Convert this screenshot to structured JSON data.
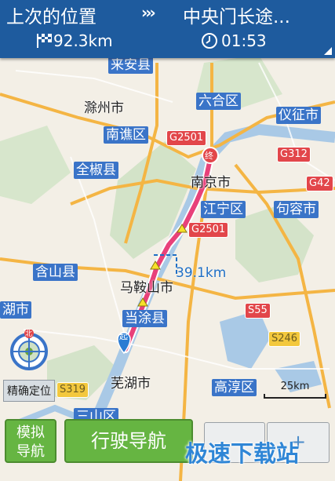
{
  "header": {
    "origin": "上次的位置",
    "destination": "中央门长途...",
    "distance": "92.3km",
    "duration": "01:53"
  },
  "map": {
    "places": [
      {
        "name": "来安县",
        "style": "blue"
      },
      {
        "name": "六合区",
        "style": "blue"
      },
      {
        "name": "滁州市",
        "style": "plain"
      },
      {
        "name": "仪征市",
        "style": "blue"
      },
      {
        "name": "南谯区",
        "style": "blue"
      },
      {
        "name": "全椒县",
        "style": "blue"
      },
      {
        "name": "南京市",
        "style": "plain"
      },
      {
        "name": "江宁区",
        "style": "blue"
      },
      {
        "name": "句容市",
        "style": "blue"
      },
      {
        "name": "含山县",
        "style": "blue"
      },
      {
        "name": "马鞍山市",
        "style": "plain"
      },
      {
        "name": "当涂县",
        "style": "blue"
      },
      {
        "name": "湖市",
        "style": "blue"
      },
      {
        "name": "芜湖市",
        "style": "plain"
      },
      {
        "name": "高淳区",
        "style": "blue"
      },
      {
        "name": "三山区",
        "style": "blue"
      }
    ],
    "highways": [
      "G2501",
      "G312",
      "G42",
      "G2501",
      "S55",
      "S246",
      "S319"
    ],
    "route_distance": "39.1km",
    "start_marker": "起",
    "end_marker": "终",
    "north_marker": "北",
    "scale": "25km"
  },
  "controls": {
    "precise_locate": "精确定位",
    "simulate_line1": "模拟",
    "simulate_line2": "导航",
    "drive_nav": "行驶导航",
    "zoom_in": "+"
  },
  "watermark": "极速下载站",
  "colors": {
    "header_bg": "#1e5b9e",
    "route": "#e8417a",
    "button_green": "#66b542"
  }
}
